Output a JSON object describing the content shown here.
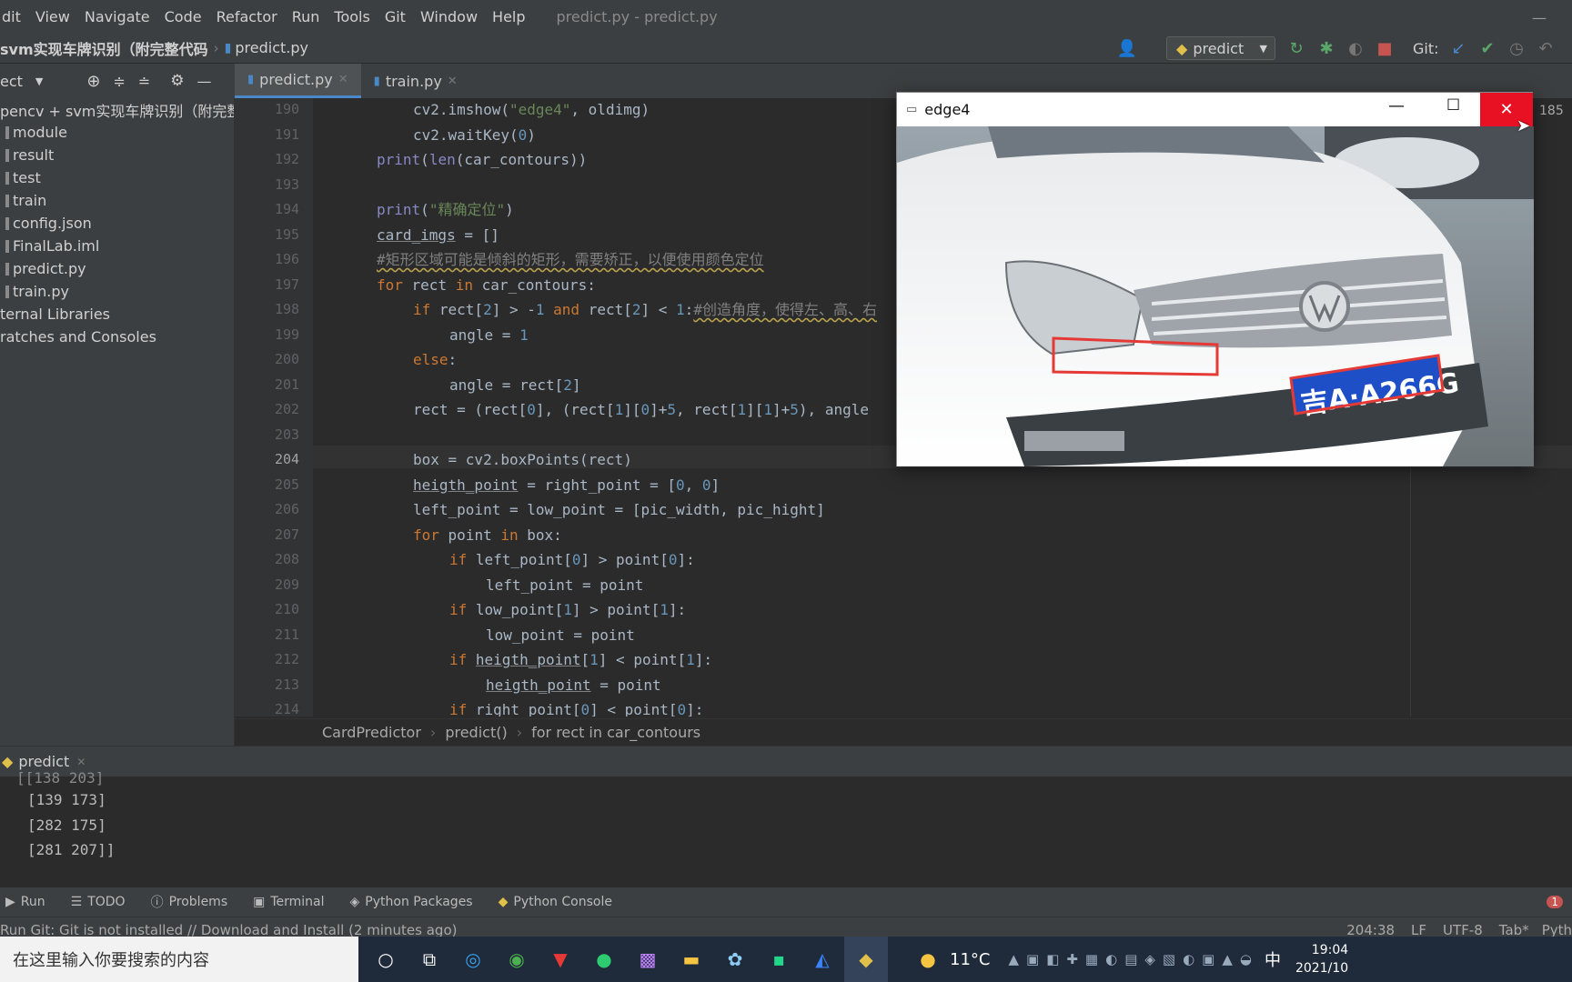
{
  "menubar": {
    "items": [
      "dit",
      "View",
      "Navigate",
      "Code",
      "Refactor",
      "Run",
      "Tools",
      "Git",
      "Window",
      "Help"
    ],
    "title": "predict.py - predict.py",
    "minimize": "—"
  },
  "navbar": {
    "project": "svm实现车牌识别（附完整代码",
    "file": "predict.py",
    "run_config": "predict",
    "git_label": "Git:"
  },
  "project_panel": {
    "header": "ect",
    "tree": [
      {
        "label": "pencv + svm实现车牌识别（附完整代码",
        "indent": 0
      },
      {
        "label": "module",
        "indent": 1
      },
      {
        "label": "result",
        "indent": 1
      },
      {
        "label": "test",
        "indent": 1
      },
      {
        "label": "train",
        "indent": 1
      },
      {
        "label": "config.json",
        "indent": 1
      },
      {
        "label": "FinalLab.iml",
        "indent": 1
      },
      {
        "label": "predict.py",
        "indent": 1
      },
      {
        "label": "train.py",
        "indent": 1
      },
      {
        "label": "ternal Libraries",
        "indent": 0
      },
      {
        "label": "ratches and Consoles",
        "indent": 0
      }
    ]
  },
  "tabs": [
    {
      "label": "predict.py",
      "active": true
    },
    {
      "label": "train.py",
      "active": false
    }
  ],
  "editor": {
    "line_numbers": [
      "190",
      "191",
      "192",
      "193",
      "194",
      "195",
      "196",
      "197",
      "198",
      "199",
      "200",
      "201",
      "202",
      "203",
      "204",
      "205",
      "206",
      "207",
      "208",
      "209",
      "210",
      "211",
      "212",
      "213",
      "214"
    ],
    "current_line": "204",
    "right_gutter_number": "185",
    "lines": [
      "cv2.imshow(\"edge4\", oldimg)",
      "cv2.waitKey(0)",
      "print(len(car_contours))",
      "",
      "print(\"精确定位\")",
      "card_imgs = []",
      "#矩形区域可能是倾斜的矩形，需要矫正，以便使用颜色定位",
      "for rect in car_contours:",
      "if rect[2] > -1 and rect[2] < 1:#创造角度，使得左、高、右",
      "angle = 1",
      "else:",
      "angle = rect[2]",
      "rect = (rect[0], (rect[1][0]+5, rect[1][1]+5), angle",
      "",
      "box = cv2.boxPoints(rect)",
      "heigth_point = right_point = [0, 0]",
      "left_point = low_point = [pic_width, pic_hight]",
      "for point in box:",
      "if left_point[0] > point[0]:",
      "left_point = point",
      "if low_point[1] > point[1]:",
      "low_point = point",
      "if heigth_point[1] < point[1]:",
      "heigth_point = point",
      "if right_point[0] < point[0]:"
    ]
  },
  "editor_breadcrumb": [
    "CardPredictor",
    "predict()",
    "for rect in car_contours"
  ],
  "run_panel": {
    "tab": "predict",
    "output": [
      "[[138 203]",
      "[139 173]",
      "[282 175]",
      "[281 207]]"
    ]
  },
  "tool_tabs": [
    "Run",
    "TODO",
    "Problems",
    "Terminal",
    "Python Packages",
    "Python Console"
  ],
  "notification_count": "1",
  "status": {
    "message": "Run Git: Git is not installed // Download and Install (2 minutes ago)",
    "position": "204:38",
    "line_sep": "LF",
    "encoding": "UTF-8",
    "indent": "Tab*",
    "interpreter": "Pyth"
  },
  "cv_window": {
    "title": "edge4",
    "plate_text": "吉A·A266G"
  },
  "taskbar": {
    "search_placeholder": "在这里输入你要搜索的内容",
    "weather": "11°C",
    "ime": "中",
    "time": "19:04",
    "date": "2021/10"
  },
  "colors": {
    "accent": "#4a88c7",
    "close_red": "#e81123",
    "keyword": "#cc7832",
    "string": "#6a8759",
    "number": "#6897bb"
  }
}
